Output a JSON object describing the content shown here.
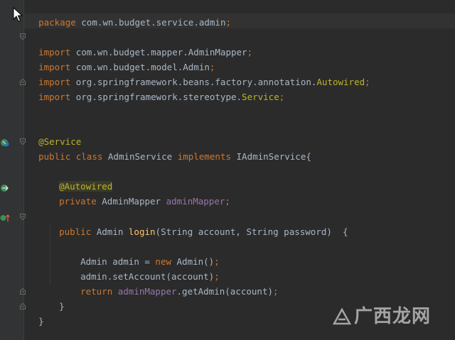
{
  "code": {
    "line1": {
      "kw": "package",
      "text": " com.wn.budget.service.admin",
      "semi": ";"
    },
    "import1": {
      "kw": "import",
      "text": " com.wn.budget.mapper.AdminMapper",
      "semi": ";"
    },
    "import2": {
      "kw": "import",
      "text": " com.wn.budget.model.Admin",
      "semi": ";"
    },
    "import3": {
      "kw": "import",
      "text": " org.springframework.beans.factory.annotation.",
      "cls": "Autowired",
      "semi": ";"
    },
    "import4": {
      "kw": "import",
      "text": " org.springframework.stereotype.",
      "cls": "Service",
      "semi": ";"
    },
    "annotation_service": "@Service",
    "class_decl": {
      "kw1": "public class",
      "name": " AdminService ",
      "kw2": "implements",
      "iface": " IAdminService{"
    },
    "annotation_autowired": "@Autowired",
    "field_decl": {
      "kw": "private",
      "type": " AdminMapper ",
      "name": "adminMapper",
      "semi": ";"
    },
    "method_decl": {
      "kw": "public",
      "type": " Admin ",
      "name": "login",
      "params": "(String account, String password)  {"
    },
    "body1": {
      "pre": "Admin admin = ",
      "kw": "new",
      "post": " Admin()",
      "semi": ";"
    },
    "body2": {
      "text": "admin.setAccount(account)",
      "semi": ";"
    },
    "body3": {
      "kw": "return",
      "field": " adminMapper",
      "post": ".getAdmin(account)",
      "semi": ";"
    },
    "close_method": "}",
    "close_class": "}"
  },
  "watermark": {
    "text": "广西龙网"
  },
  "colors": {
    "background": "#2b2b2b",
    "gutter": "#313335",
    "keyword": "#cc7832",
    "annotation": "#bbb529",
    "field": "#9876aa",
    "method": "#ffc66d",
    "text": "#a9b7c6"
  },
  "icons": [
    "mouse-pointer-icon",
    "implements-gutter-icon",
    "autowired-bean-gutter-icon",
    "override-method-gutter-icon",
    "fold-marker-icon"
  ]
}
